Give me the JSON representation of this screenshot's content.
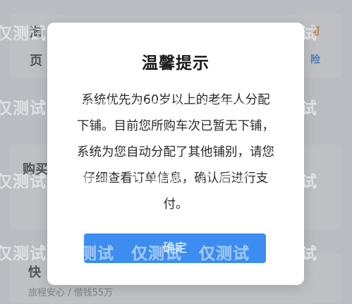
{
  "background": {
    "top_fragment": "淘",
    "line2_fragment": "页",
    "right_top_fragment": "可",
    "right_line2_fragment": "险",
    "buy_fragment": "购买",
    "bottom_fragment": "快",
    "bottom_row": "旅程安心 / 借钱55万"
  },
  "dialog": {
    "title": "温馨提示",
    "lines": [
      "系统优先为60岁以上的老年人分配",
      "下铺。目前您所购车次已暂无下铺，",
      "系统为您自动分配了其他铺别，请您",
      "仔细查看订单信息，确认后进行支",
      "付。"
    ],
    "confirm_label": "确定"
  },
  "watermark_text": "仅测试",
  "colors": {
    "primary": "#3d8df0",
    "overlay": "#787c82"
  }
}
